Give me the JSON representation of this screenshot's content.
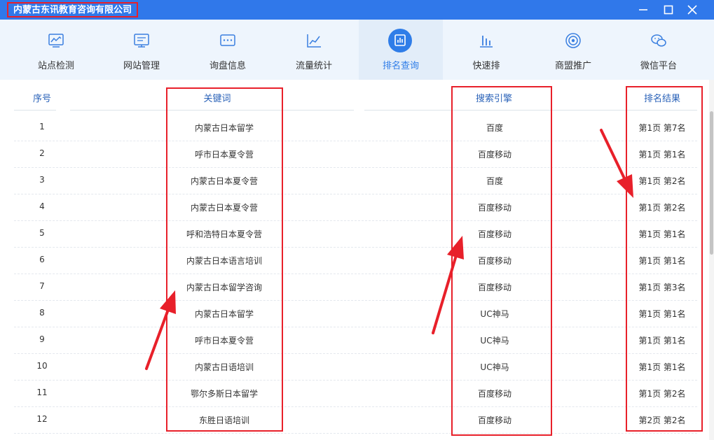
{
  "window": {
    "title": "内蒙古东讯教育咨询有限公司"
  },
  "toolbar": {
    "items": [
      {
        "label": "站点检测",
        "icon": "monitor-chart-icon"
      },
      {
        "label": "网站管理",
        "icon": "monitor-list-icon"
      },
      {
        "label": "询盘信息",
        "icon": "chat-dots-icon"
      },
      {
        "label": "流量统计",
        "icon": "line-chart-icon"
      },
      {
        "label": "排名查询",
        "icon": "bar-chart-icon",
        "active": true
      },
      {
        "label": "快速排",
        "icon": "bars-icon"
      },
      {
        "label": "商盟推广",
        "icon": "target-icon"
      },
      {
        "label": "微信平台",
        "icon": "wechat-icon"
      }
    ]
  },
  "table": {
    "headers": {
      "index": "序号",
      "keyword": "关键词",
      "engine": "搜索引擎",
      "result": "排名结果"
    },
    "rows": [
      {
        "index": "1",
        "keyword": "内蒙古日本留学",
        "engine": "百度",
        "result": "第1页 第7名"
      },
      {
        "index": "2",
        "keyword": "呼市日本夏令营",
        "engine": "百度移动",
        "result": "第1页 第1名"
      },
      {
        "index": "3",
        "keyword": "内蒙古日本夏令营",
        "engine": "百度",
        "result": "第1页 第2名"
      },
      {
        "index": "4",
        "keyword": "内蒙古日本夏令营",
        "engine": "百度移动",
        "result": "第1页 第2名"
      },
      {
        "index": "5",
        "keyword": "呼和浩特日本夏令营",
        "engine": "百度移动",
        "result": "第1页 第1名"
      },
      {
        "index": "6",
        "keyword": "内蒙古日本语言培训",
        "engine": "百度移动",
        "result": "第1页 第1名"
      },
      {
        "index": "7",
        "keyword": "内蒙古日本留学咨询",
        "engine": "百度移动",
        "result": "第1页 第3名"
      },
      {
        "index": "8",
        "keyword": "内蒙古日本留学",
        "engine": "UC神马",
        "result": "第1页 第1名"
      },
      {
        "index": "9",
        "keyword": "呼市日本夏令营",
        "engine": "UC神马",
        "result": "第1页 第1名"
      },
      {
        "index": "10",
        "keyword": "内蒙古日语培训",
        "engine": "UC神马",
        "result": "第1页 第1名"
      },
      {
        "index": "11",
        "keyword": "鄂尔多斯日本留学",
        "engine": "百度移动",
        "result": "第1页 第2名"
      },
      {
        "index": "12",
        "keyword": "东胜日语培训",
        "engine": "百度移动",
        "result": "第2页 第2名"
      }
    ]
  },
  "colors": {
    "titlebar": "#3078ea",
    "accent": "#2f7de8",
    "highlight": "#e8202a",
    "header_text": "#2a62b8"
  }
}
